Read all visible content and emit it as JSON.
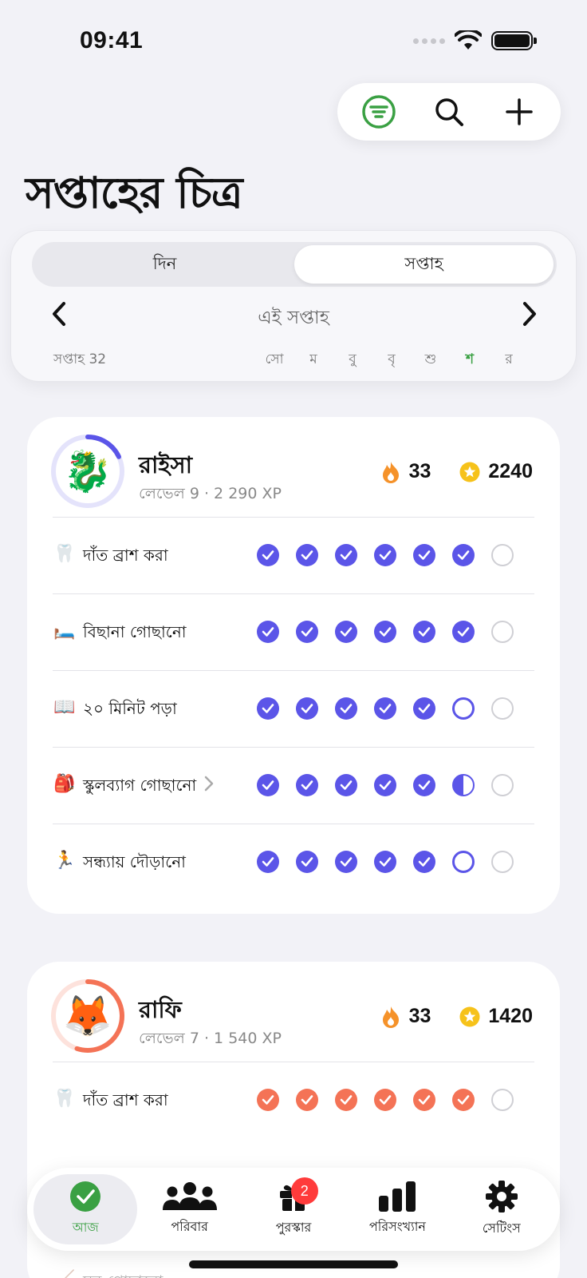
{
  "status": {
    "time": "09:41"
  },
  "toolbar": {
    "filter_icon": "filter-icon",
    "search_icon": "search-icon",
    "add_icon": "plus-icon"
  },
  "page": {
    "title": "সপ্তাহের চিত্র"
  },
  "week": {
    "segments": [
      "দিন",
      "সপ্তাহ"
    ],
    "active_segment": "সপ্তাহ",
    "label": "এই সপ্তাহ",
    "week_number": "সপ্তাহ 32",
    "days": [
      "সো",
      "ম",
      "বু",
      "বৃ",
      "শু",
      "শ",
      "র"
    ],
    "today_index": 5
  },
  "colors": {
    "accent_purple": "#5b55e8",
    "accent_orange": "#f47356",
    "green": "#3aa043",
    "streak": "#f5922a",
    "star": "#f6c21a"
  },
  "kids": [
    {
      "name": "রাইসা",
      "level": "লেভেল 9 · 2 290 XP",
      "avatar": "🐉",
      "streak": "33",
      "stars": "2240",
      "level_progress": 0.18,
      "habits": [
        {
          "emoji": "🦷",
          "label": "দাঁত ব্রাশ করা",
          "status": [
            "done",
            "done",
            "done",
            "done",
            "done",
            "done",
            "empty"
          ]
        },
        {
          "emoji": "🛏️",
          "label": "বিছানা গোছানো",
          "status": [
            "done",
            "done",
            "done",
            "done",
            "done",
            "done",
            "empty"
          ]
        },
        {
          "emoji": "📖",
          "label": "২০ মিনিট পড়া",
          "status": [
            "done",
            "done",
            "done",
            "done",
            "done",
            "today",
            "empty"
          ]
        },
        {
          "emoji": "🎒",
          "label": "স্কুলব্যাগ গোছানো",
          "has_chevron": true,
          "status": [
            "done",
            "done",
            "done",
            "done",
            "done",
            "half",
            "empty"
          ]
        },
        {
          "emoji": "🏃",
          "label": "সন্ধ্যায় দৌড়ানো",
          "status": [
            "done",
            "done",
            "done",
            "done",
            "done",
            "today",
            "empty"
          ]
        }
      ]
    },
    {
      "name": "রাফি",
      "level": "লেভেল 7 · 1 540 XP",
      "avatar": "🦊",
      "streak": "33",
      "stars": "1420",
      "level_progress": 0.55,
      "habits": [
        {
          "emoji": "🦷",
          "label": "দাঁত ব্রাশ করা",
          "status": [
            "done",
            "done",
            "done",
            "done",
            "done",
            "done",
            "empty"
          ]
        }
      ]
    }
  ],
  "tabs": [
    {
      "label": "আজ",
      "icon": "check-circle-icon",
      "active": true
    },
    {
      "label": "পরিবার",
      "icon": "family-icon"
    },
    {
      "label": "পুরস্কার",
      "icon": "gift-icon",
      "badge": "2"
    },
    {
      "label": "পরিসংখ্যান",
      "icon": "bar-chart-icon"
    },
    {
      "label": "সেটিংস",
      "icon": "gear-icon"
    }
  ],
  "ghost_rows": [
    {
      "label": "ঘর গোছানো",
      "emoji": "🧹"
    }
  ]
}
